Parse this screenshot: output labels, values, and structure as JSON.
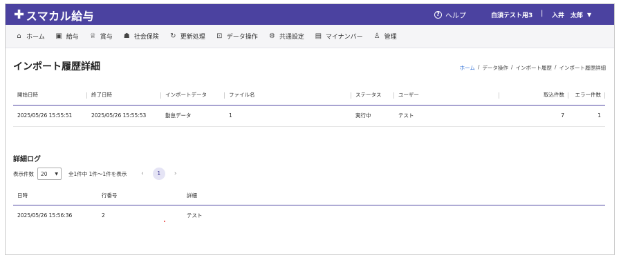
{
  "app": {
    "logo_text": "スマカル給与",
    "help_label": "ヘルプ",
    "tenant_name": "白須テスト用3",
    "separator": "|",
    "user_name": "入井　太郎"
  },
  "nav": {
    "items": [
      {
        "label": "ホーム",
        "icon": "home-icon"
      },
      {
        "label": "給与",
        "icon": "payroll-icon"
      },
      {
        "label": "賞与",
        "icon": "trophy-icon"
      },
      {
        "label": "社会保険",
        "icon": "people-icon"
      },
      {
        "label": "更新処理",
        "icon": "refresh-icon"
      },
      {
        "label": "データ操作",
        "icon": "import-icon"
      },
      {
        "label": "共通設定",
        "icon": "gear-icon"
      },
      {
        "label": "マイナンバー",
        "icon": "card-icon"
      },
      {
        "label": "管理",
        "icon": "user-icon"
      }
    ]
  },
  "page": {
    "title": "インポート履歴詳細",
    "breadcrumb": [
      "ホーム",
      "データ操作",
      "インポート履歴",
      "インポート履歴詳細"
    ],
    "breadcrumb_sep": "/"
  },
  "import_table": {
    "headers": [
      "開始日時",
      "終了日時",
      "インポートデータ",
      "ファイル名",
      "ステータス",
      "ユーザー",
      "",
      "取込件数",
      "エラー件数"
    ],
    "rows": [
      [
        "2025/05/26 15:55:51",
        "2025/05/26 15:55:53",
        "勤怠データ",
        "1",
        "実行中",
        "テスト",
        "",
        "7",
        "1"
      ]
    ]
  },
  "log_section": {
    "title": "詳細ログ",
    "page_size_label": "表示件数",
    "page_size_value": "20",
    "summary": "全1件中 1件〜1件を表示",
    "current_page": "1",
    "headers": [
      "日時",
      "行番号",
      "詳細"
    ],
    "rows": [
      [
        "2025/05/26 15:56:36",
        "2",
        "テスト"
      ]
    ]
  }
}
